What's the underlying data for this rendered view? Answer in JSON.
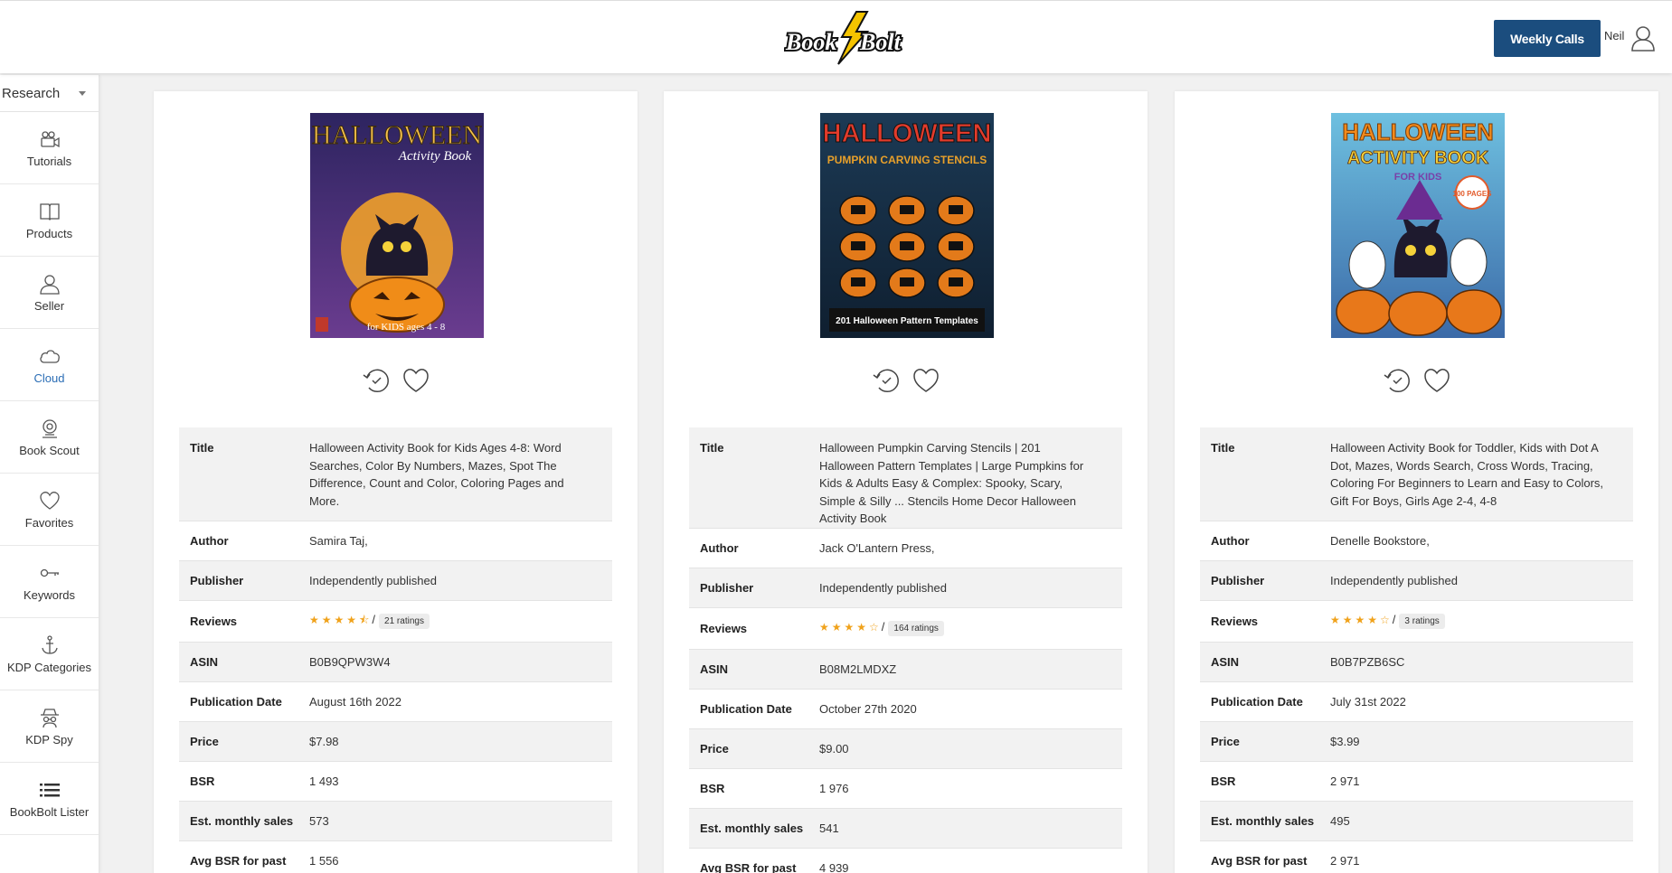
{
  "header": {
    "logo_text": "Book Bolt",
    "weekly_calls_label": "Weekly Calls",
    "user_name": "Neil"
  },
  "sidebar": {
    "dropdown_value": "Research",
    "items": [
      {
        "label": "Tutorials",
        "icon": "video-icon"
      },
      {
        "label": "Products",
        "icon": "book-icon"
      },
      {
        "label": "Seller",
        "icon": "user-icon"
      },
      {
        "label": "Cloud",
        "icon": "cloud-icon"
      },
      {
        "label": "Book Scout",
        "icon": "scout-icon"
      },
      {
        "label": "Favorites",
        "icon": "heart-icon"
      },
      {
        "label": "Keywords",
        "icon": "key-icon"
      },
      {
        "label": "KDP Categories",
        "icon": "anchor-icon"
      },
      {
        "label": "KDP Spy",
        "icon": "spy-icon"
      },
      {
        "label": "BookBolt Lister",
        "icon": "list-icon"
      }
    ]
  },
  "labels": {
    "title": "Title",
    "author": "Author",
    "publisher": "Publisher",
    "reviews": "Reviews",
    "asin": "ASIN",
    "pub_date": "Publication Date",
    "price": "Price",
    "bsr": "BSR",
    "est_sales": "Est. monthly sales",
    "avg_bsr": "Avg BSR for past"
  },
  "products": [
    {
      "cover": {
        "title": "HALLOWEEN",
        "subtitle": "Activity Book",
        "footer": "for KIDS ages 4 - 8"
      },
      "title": "Halloween Activity Book for Kids Ages 4-8: Word Searches, Color By Numbers, Mazes, Spot The Difference, Count and Color, Coloring Pages and More.",
      "author": "Samira Taj,",
      "publisher": "Independently published",
      "stars": "★★★★⯪",
      "rating": 4.5,
      "ratings_count": "21 ratings",
      "asin": "B0B9QPW3W4",
      "pub_date": "August 16th 2022",
      "price": "$7.98",
      "bsr": "1 493",
      "est_sales": "573",
      "avg_bsr": "1 556"
    },
    {
      "cover": {
        "title": "HALLOWEEN",
        "subtitle": "PUMPKIN CARVING STENCILS",
        "footer": "201 Halloween Pattern Templates"
      },
      "title": "Halloween Pumpkin Carving Stencils | 201 Halloween Pattern Templates | Large Pumpkins for Kids & Adults Easy & Complex: Spooky, Scary, Simple & Silly ... Stencils Home Decor Halloween Activity Book",
      "author": "Jack O'Lantern Press,",
      "publisher": "Independently published",
      "stars": "★★★★☆",
      "rating": 4,
      "ratings_count": "164 ratings",
      "asin": "B08M2LMDXZ",
      "pub_date": "October 27th 2020",
      "price": "$9.00",
      "bsr": "1 976",
      "est_sales": "541",
      "avg_bsr": "4 939"
    },
    {
      "cover": {
        "title": "HALLOWEEN",
        "subtitle": "ACTIVITY BOOK",
        "footer": "FOR KIDS",
        "badge": "100 PAGES"
      },
      "title": "Halloween Activity Book for Toddler, Kids with Dot A Dot, Mazes, Words Search, Cross Words, Tracing, Coloring For Beginners to Learn and Easy to Colors, Gift For Boys, Girls Age 2-4, 4-8",
      "author": "Denelle Bookstore,",
      "publisher": "Independently published",
      "stars": "★★★★☆",
      "rating": 4,
      "ratings_count": "3 ratings",
      "asin": "B0B7PZB6SC",
      "pub_date": "July 31st 2022",
      "price": "$3.99",
      "bsr": "2 971",
      "est_sales": "495",
      "avg_bsr": "2 971"
    }
  ],
  "colors": {
    "accent": "#1b4d7e",
    "link": "#2a5a92",
    "star": "#f0a21b"
  }
}
